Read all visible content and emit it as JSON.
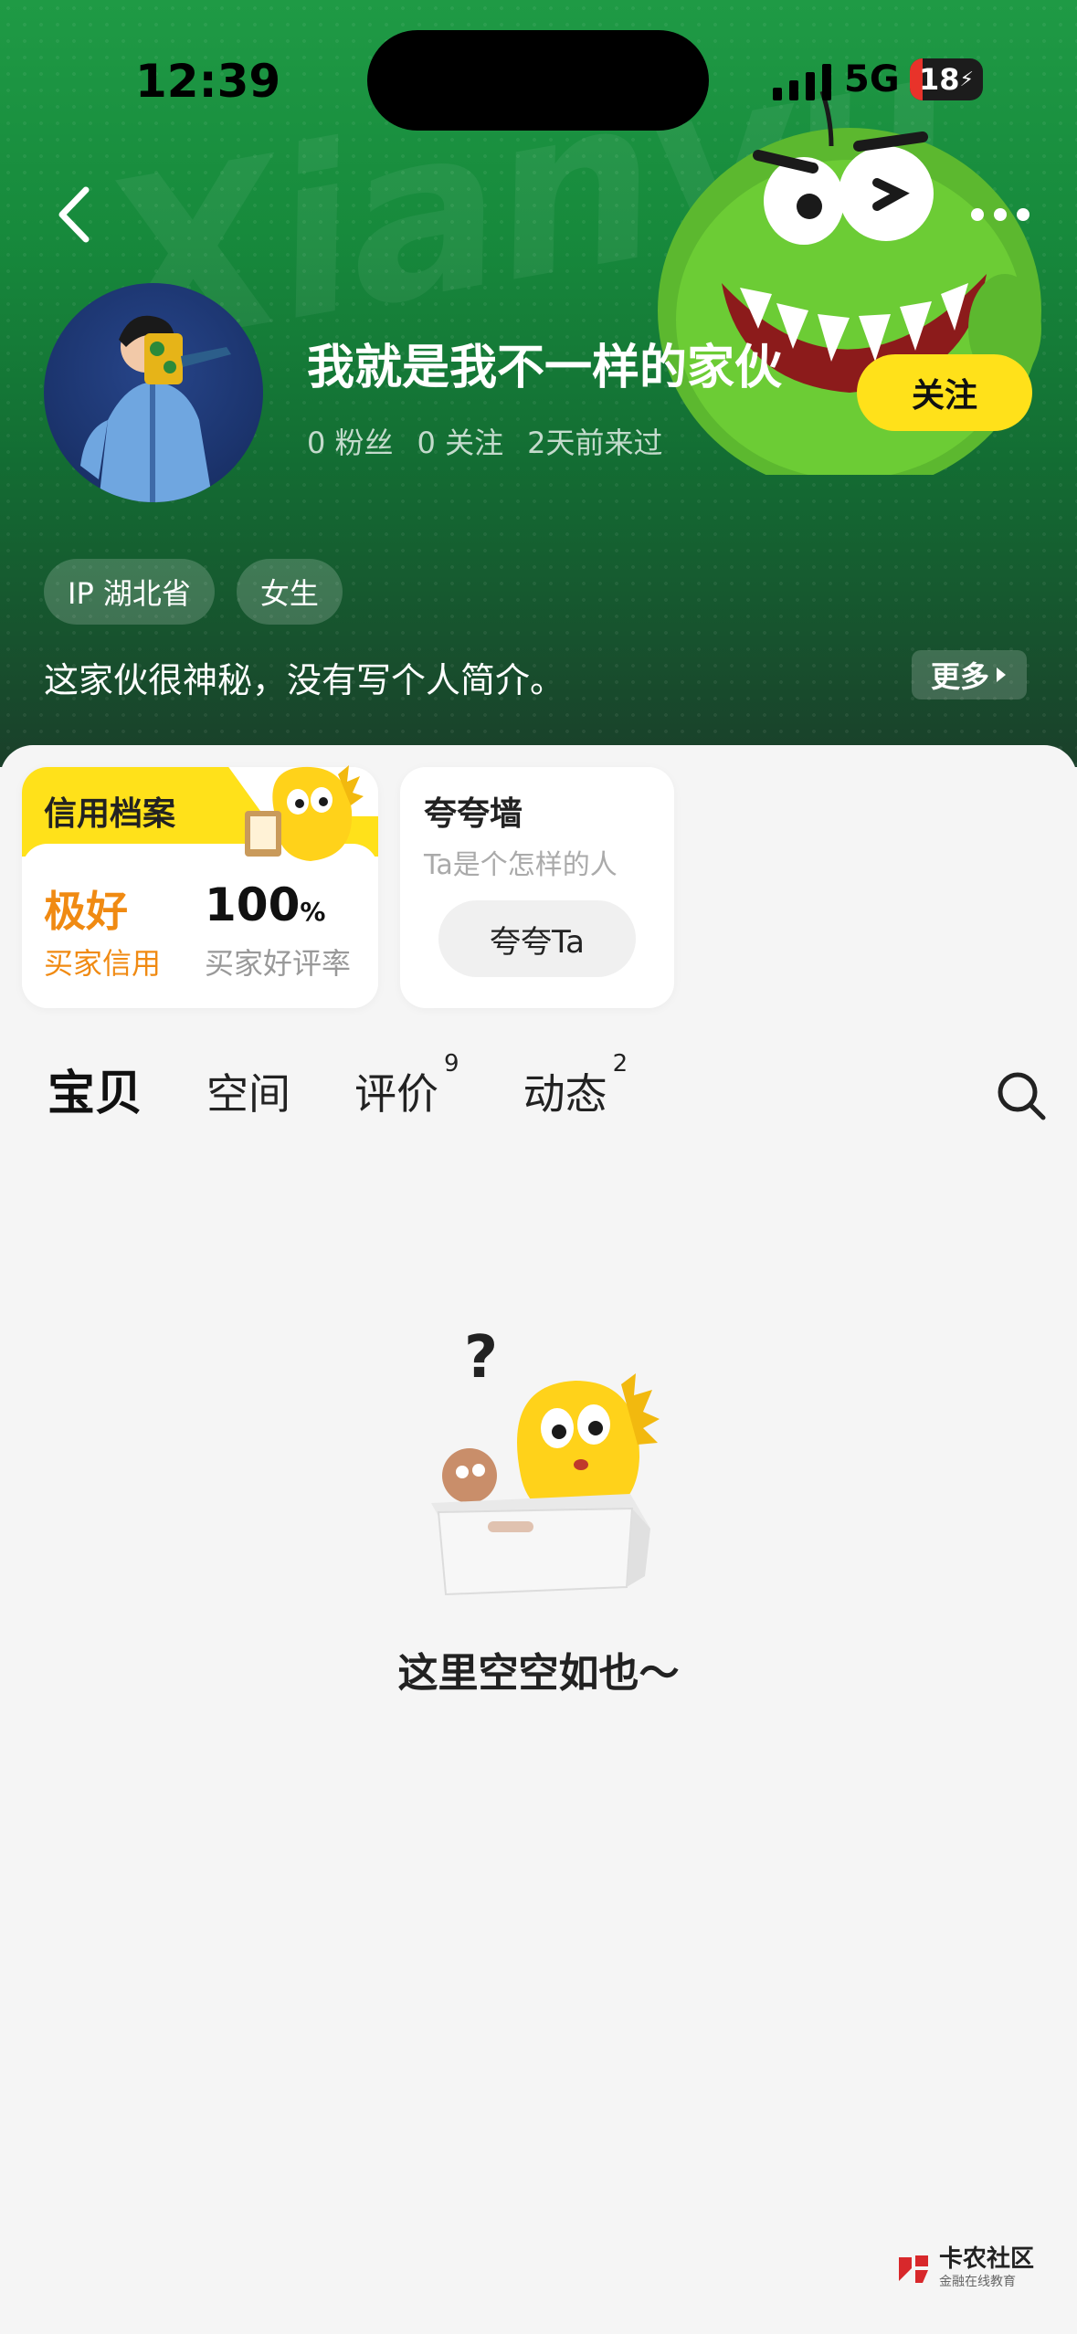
{
  "status_bar": {
    "time": "12:39",
    "network": "5G",
    "battery": "18",
    "battery_level": 0.18
  },
  "header": {
    "back_icon": "chevron-left-icon",
    "more_icon": "ellipsis-icon",
    "brand_watermark": "Xianyu"
  },
  "profile": {
    "username": "我就是我不一样的家伙",
    "stats": [
      "0 粉丝",
      "0 关注",
      "2天前来过"
    ],
    "follow_label": "关注",
    "tags": [
      "IP 湖北省",
      "女生"
    ],
    "bio": "这家伙很神秘，没有写个人简介。",
    "more_label": "更多"
  },
  "credit_card": {
    "title": "信用档案",
    "level": "极好",
    "level_label": "买家信用",
    "rate_value": "100",
    "rate_unit": "%",
    "rate_label": "买家好评率",
    "accent": "#ffe11a",
    "level_color": "#f08a12"
  },
  "praise_card": {
    "title": "夸夸墙",
    "subtitle": "Ta是个怎样的人",
    "button_label": "夸夸Ta"
  },
  "tabs": [
    {
      "label": "宝贝",
      "count": ""
    },
    {
      "label": "空间",
      "count": ""
    },
    {
      "label": "评价",
      "count": "9"
    },
    {
      "label": "动态",
      "count": "2"
    }
  ],
  "empty_state": {
    "text": "这里空空如也～"
  },
  "watermark": {
    "title": "卡农社区",
    "subtitle": "金融在线教育"
  }
}
